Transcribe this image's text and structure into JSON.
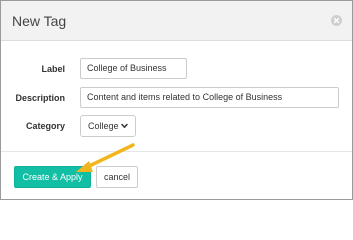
{
  "dialog": {
    "title": "New Tag",
    "close_icon": "close-circle-icon"
  },
  "form": {
    "label": {
      "label": "Label",
      "value": "College of Business"
    },
    "description": {
      "label": "Description",
      "value": "Content and items related to College of Business"
    },
    "category": {
      "label": "Category",
      "selected": "College",
      "icon": "chevron-down-icon"
    }
  },
  "footer": {
    "primary_label": "Create & Apply",
    "cancel_label": "cancel"
  },
  "annotation": {
    "icon": "arrow-icon",
    "color": "#f2b51b"
  },
  "colors": {
    "accent": "#12bfa5",
    "header_bg": "#f2f2f2"
  }
}
